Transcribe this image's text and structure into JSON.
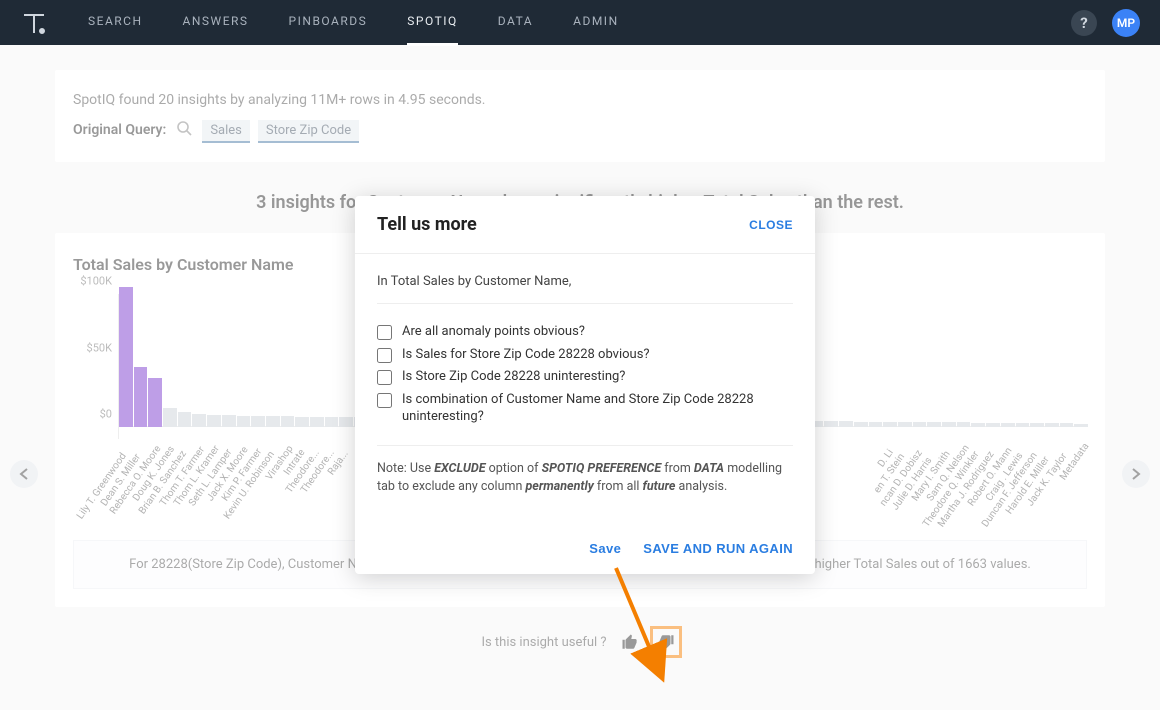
{
  "nav": {
    "items": [
      "SEARCH",
      "ANSWERS",
      "PINBOARDS",
      "SPOTIQ",
      "DATA",
      "ADMIN"
    ],
    "active_index": 3,
    "avatar_initials": "MP",
    "help_glyph": "?"
  },
  "summary": {
    "text": "SpotIQ found 20 insights by analyzing 11M+ rows in 4.95 seconds.",
    "original_label": "Original Query:",
    "pills": [
      "Sales",
      "Store Zip Code"
    ]
  },
  "insight_title": "3 insights for Customer Name have significantly higher Total Sales than the rest.",
  "chart_data": {
    "type": "bar",
    "title": "Total Sales by Customer Name",
    "ylabel": "",
    "ylim": [
      0,
      100000
    ],
    "yticks": [
      {
        "v": 0,
        "label": "$0"
      },
      {
        "v": 50000,
        "label": "$50K"
      },
      {
        "v": 100000,
        "label": "$100K"
      }
    ],
    "categories": [
      "Lily T. Greenwood",
      "Dean S. Miller",
      "Rebecca O. Moore",
      "Doug K. Jones",
      "Brian B. Sanchez",
      "Thom T. Farmer",
      "Thom L. Kramer",
      "Seth L. Lamper",
      "Jack X. Moore",
      "Kim P. Farmer",
      "Kevin U. Robinson",
      "Virashop",
      "Intrate",
      "Theodore...",
      "Theodore...",
      "Raja...",
      "",
      "",
      "",
      "",
      "",
      "",
      "",
      "",
      "",
      "",
      "",
      "",
      "",
      "",
      "",
      "",
      "",
      "",
      "",
      "",
      "",
      "",
      "",
      "",
      "",
      "",
      "",
      "",
      "",
      "",
      "",
      "",
      "",
      "",
      "",
      "",
      "D. Li",
      "en T. Stein",
      "ncan D. Dobisz",
      "Julie D. Harris",
      "Mary I. Smith",
      "Sam Q. Nelson",
      "Theodore Q. Winkler",
      "Martha J. Rodriguez",
      "Robert O. Mann",
      "Craig . Lewis",
      "Duncan F. Jefferson",
      "Harold E. Miller",
      "Jack K. Taylor",
      "Metadata"
    ],
    "values": [
      105000,
      45000,
      37000,
      14000,
      11000,
      9500,
      9000,
      8800,
      8600,
      8400,
      8200,
      8000,
      7900,
      7800,
      7700,
      7600,
      7500,
      7400,
      7300,
      7200,
      7100,
      7000,
      6900,
      6800,
      6700,
      6600,
      6500,
      6400,
      6300,
      6200,
      6100,
      6000,
      5900,
      5800,
      5700,
      5600,
      5500,
      5400,
      5300,
      5200,
      5100,
      5000,
      4900,
      4800,
      4700,
      4600,
      4500,
      4400,
      4300,
      4200,
      4100,
      4000,
      3900,
      3800,
      3700,
      3600,
      3500,
      3400,
      3300,
      3200,
      3100,
      3000,
      2900,
      2800,
      2700,
      2600
    ],
    "highlight_indices": [
      0,
      1,
      2
    ]
  },
  "explanation": "For 28228(Store Zip Code), Customer Name \"Lily T. Greenwood\", \"Dean S. Miller\", \"Rebecca O. Moore\" have significantly higher Total Sales out of 1663 values.",
  "feedback": {
    "prompt": "Is this insight useful ?"
  },
  "modal": {
    "title": "Tell us more",
    "close": "CLOSE",
    "lead": "In Total Sales by Customer Name,",
    "checks": [
      "Are all anomaly points obvious?",
      "Is Sales for Store Zip Code 28228 obvious?",
      "Is Store Zip Code 28228 uninteresting?",
      "Is combination of Customer Name and Store Zip Code 28228 uninteresting?"
    ],
    "note_prefix": "Note: Use ",
    "note_exclude": "EXCLUDE",
    "note_mid1": " option of ",
    "note_spotiq": "SPOTIQ PREFERENCE",
    "note_mid2": " from ",
    "note_data": "DATA",
    "note_mid3": " modelling tab to exclude any column ",
    "note_perm": "permanently",
    "note_mid4": " from all ",
    "note_future": "future",
    "note_end": " analysis.",
    "save": "Save",
    "save_run": "SAVE AND RUN AGAIN"
  }
}
